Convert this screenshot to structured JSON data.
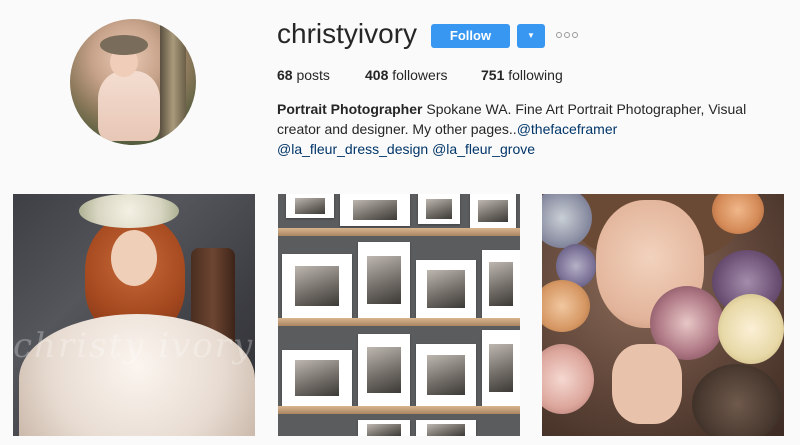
{
  "profile": {
    "username": "christyivory",
    "follow_label": "Follow",
    "dropdown_glyph": "▼",
    "more_icon": "ellipsis-icon",
    "avatar_alt": "profile photo"
  },
  "stats": {
    "posts_count": "68",
    "posts_label": "posts",
    "followers_count": "408",
    "followers_label": "followers",
    "following_count": "751",
    "following_label": "following"
  },
  "bio": {
    "title": "Portrait Photographer",
    "text": " Spokane WA. Fine Art Portrait Photographer, Visual creator and designer. My other pages..",
    "links": [
      "@thefaceframer",
      "@la_fleur_dress_design",
      "@la_fleur_grove"
    ]
  },
  "posts": [
    {
      "watermark": "christy ivory"
    },
    {},
    {}
  ],
  "colors": {
    "accent": "#3897f0",
    "link": "#003569",
    "background": "#fafafa",
    "text": "#262626"
  }
}
